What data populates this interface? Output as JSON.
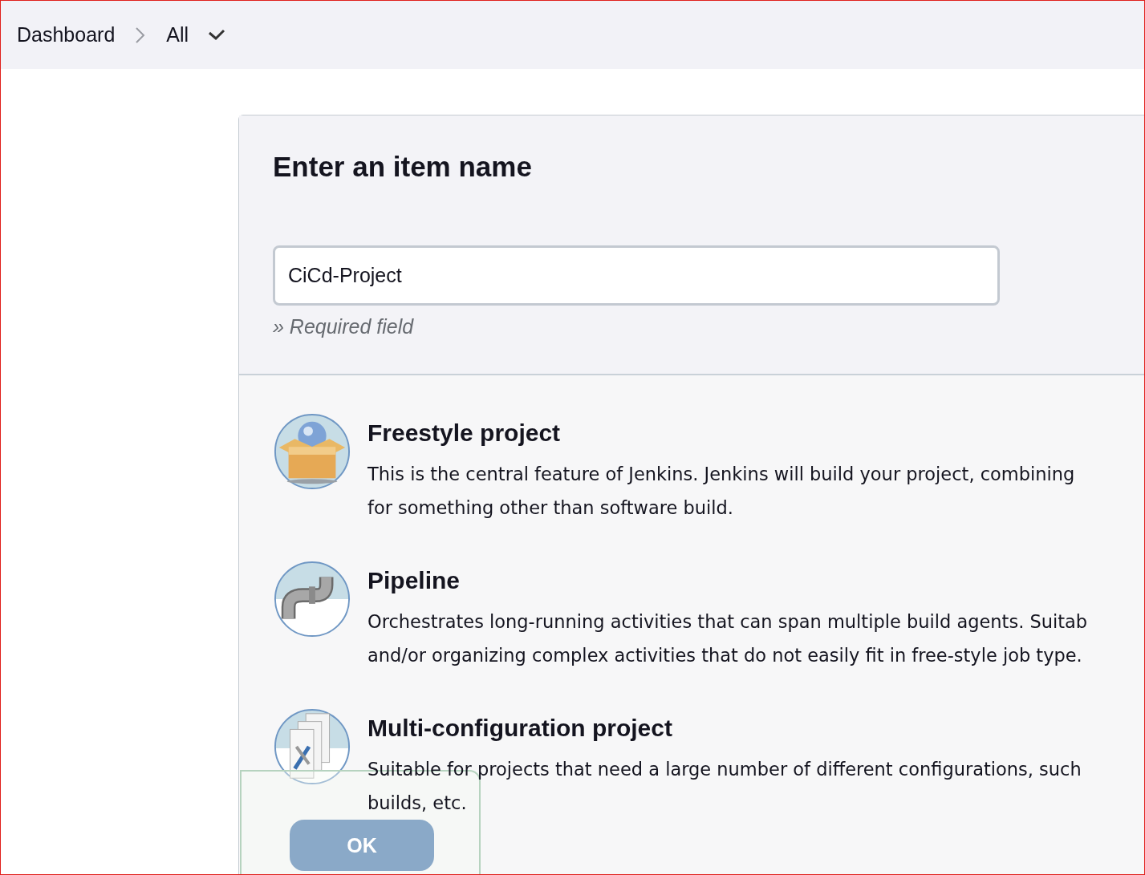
{
  "breadcrumbs": [
    {
      "label": "Dashboard"
    },
    {
      "label": "All"
    }
  ],
  "form": {
    "title": "Enter an item name",
    "item_name": {
      "value": "CiCd-Project",
      "hint": "» Required field"
    }
  },
  "item_types": [
    {
      "title": "Freestyle project",
      "description_lines": [
        "This is the central feature of Jenkins. Jenkins will build your project, combining",
        "for something other than software build."
      ]
    },
    {
      "title": "Pipeline",
      "description_lines": [
        "Orchestrates long-running activities that can span multiple build agents. Suitab",
        "and/or organizing complex activities that do not easily fit in free-style job type."
      ]
    },
    {
      "title": "Multi-configuration project",
      "description_lines": [
        "Suitable for projects that need a large number of different configurations, such",
        "builds, etc."
      ]
    }
  ],
  "ok_button": {
    "label": "OK"
  }
}
